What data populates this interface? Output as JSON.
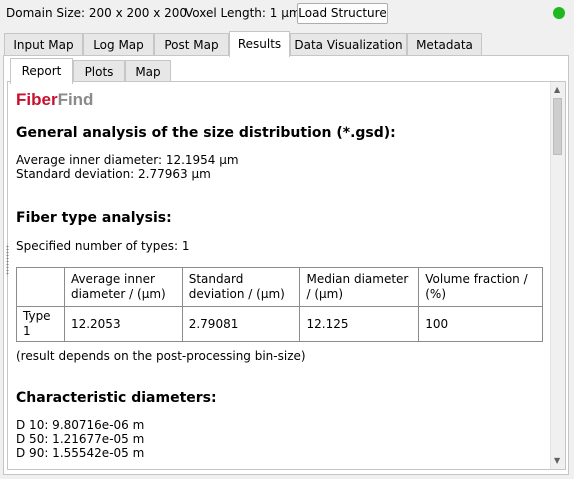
{
  "header": {
    "domain_size": "Domain Size: 200 x 200 x 200",
    "voxel_length": "Voxel Length: 1 µm",
    "load_button": "Load Structure",
    "status_color": "#1fb81f"
  },
  "main_tabs": [
    "Input Map",
    "Log Map",
    "Post Map",
    "Results",
    "Data Visualization",
    "Metadata"
  ],
  "active_main_tab": "Results",
  "sub_tabs": [
    "Report",
    "Plots",
    "Map"
  ],
  "active_sub_tab": "Report",
  "report": {
    "logo_part1": "Fiber",
    "logo_part2": "Find",
    "logo_colors": {
      "part1": "#c8102e",
      "part2": "#8a8a8a"
    },
    "size_heading": "General analysis of the size distribution (*.gsd):",
    "avg_inner": "Average inner diameter: 12.1954 µm",
    "std_dev": "Standard deviation: 2.77963 µm",
    "fiber_heading": "Fiber type analysis:",
    "num_types": "Specified number of types: 1",
    "table": {
      "headers": [
        "",
        "Average inner diameter / (µm)",
        "Standard deviation / (µm)",
        "Median diameter / (µm)",
        "Volume fraction / (%)"
      ],
      "rows": [
        [
          "Type 1",
          "12.2053",
          "2.79081",
          "12.125",
          "100"
        ]
      ]
    },
    "note": "(result depends on the post-processing bin-size)",
    "char_heading": "Characteristic diameters:",
    "d10": "D 10: 9.80716e-06 m",
    "d50": "D 50: 1.21677e-05 m",
    "d90": "D 90: 1.55542e-05 m"
  }
}
